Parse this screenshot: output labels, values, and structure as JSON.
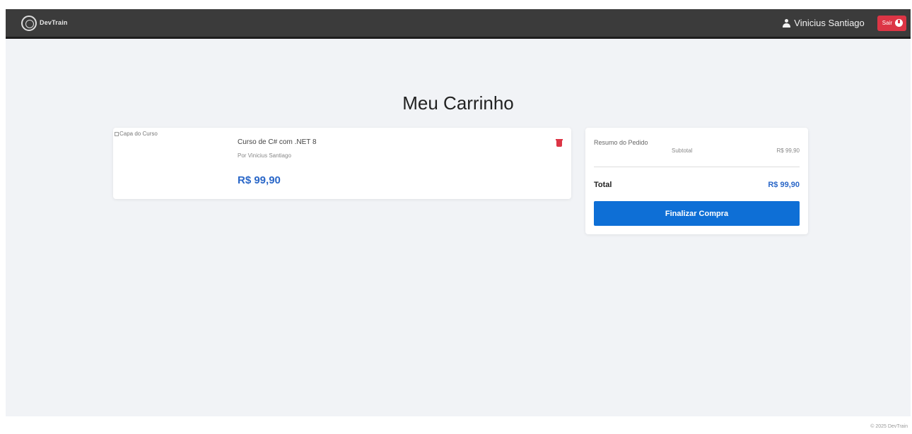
{
  "navbar": {
    "brand_text": "DevTrain",
    "user_name": "Vinicius Santiago",
    "logout_label": "Sair"
  },
  "page": {
    "title": "Meu Carrinho"
  },
  "cart": {
    "items": [
      {
        "image_alt": "Capa do Curso",
        "title": "Curso de C# com .NET 8",
        "author": "Por Vinicius Santiago",
        "price": "R$ 99,90"
      }
    ]
  },
  "summary": {
    "title": "Resumo do Pedido",
    "subtotal_label": "Subtotal",
    "subtotal_value": "R$ 99,90",
    "total_label": "Total",
    "total_value": "R$ 99,90",
    "checkout_label": "Finalizar Compra"
  },
  "footer": {
    "text": "© 2025 DevTrain"
  },
  "colors": {
    "navbar": "#3b3b3b",
    "page_bg": "#f1f3f6",
    "accent_blue": "#0e6fd6",
    "price_blue": "#2a67c8",
    "danger": "#dc3545"
  },
  "icons": [
    "brand-logo-icon",
    "user-icon",
    "power-icon",
    "trash-icon",
    "broken-image-icon"
  ]
}
